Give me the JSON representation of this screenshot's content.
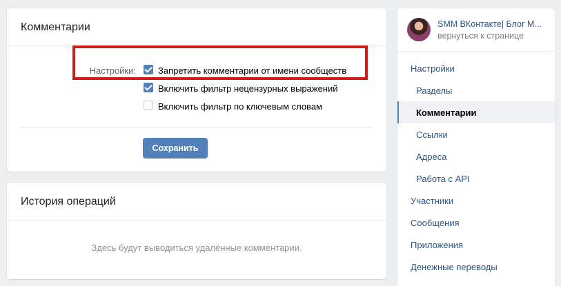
{
  "comments_card": {
    "title": "Комментарии",
    "settings_label": "Настройки:",
    "options": [
      {
        "label": "Запретить комментарии от имени сообществ",
        "checked": true
      },
      {
        "label": "Включить фильтр нецензурных выражений",
        "checked": true
      },
      {
        "label": "Включить фильтр по ключевым словам",
        "checked": false
      }
    ],
    "save_label": "Сохранить",
    "highlight_color": "#d21c1c"
  },
  "history_card": {
    "title": "История операций",
    "empty_text": "Здесь будут выводиться удалённые комментарии."
  },
  "sidebar": {
    "profile_name": "SMM ВКонтакте| Блог М...",
    "back_link": "вернуться к странице",
    "menu": [
      {
        "label": "Настройки",
        "level": "top",
        "active": false
      },
      {
        "label": "Разделы",
        "level": "sub",
        "active": false
      },
      {
        "label": "Комментарии",
        "level": "sub",
        "active": true
      },
      {
        "label": "Ссылки",
        "level": "sub",
        "active": false
      },
      {
        "label": "Адреса",
        "level": "sub",
        "active": false
      },
      {
        "label": "Работа с API",
        "level": "sub",
        "active": false
      },
      {
        "label": "Участники",
        "level": "top",
        "active": false
      },
      {
        "label": "Сообщения",
        "level": "top",
        "active": false
      },
      {
        "label": "Приложения",
        "level": "top",
        "active": false
      },
      {
        "label": "Денежные переводы",
        "level": "top",
        "active": false
      }
    ]
  },
  "colors": {
    "accent": "#5181b8",
    "link": "#2a5885",
    "background": "#edeef0"
  }
}
